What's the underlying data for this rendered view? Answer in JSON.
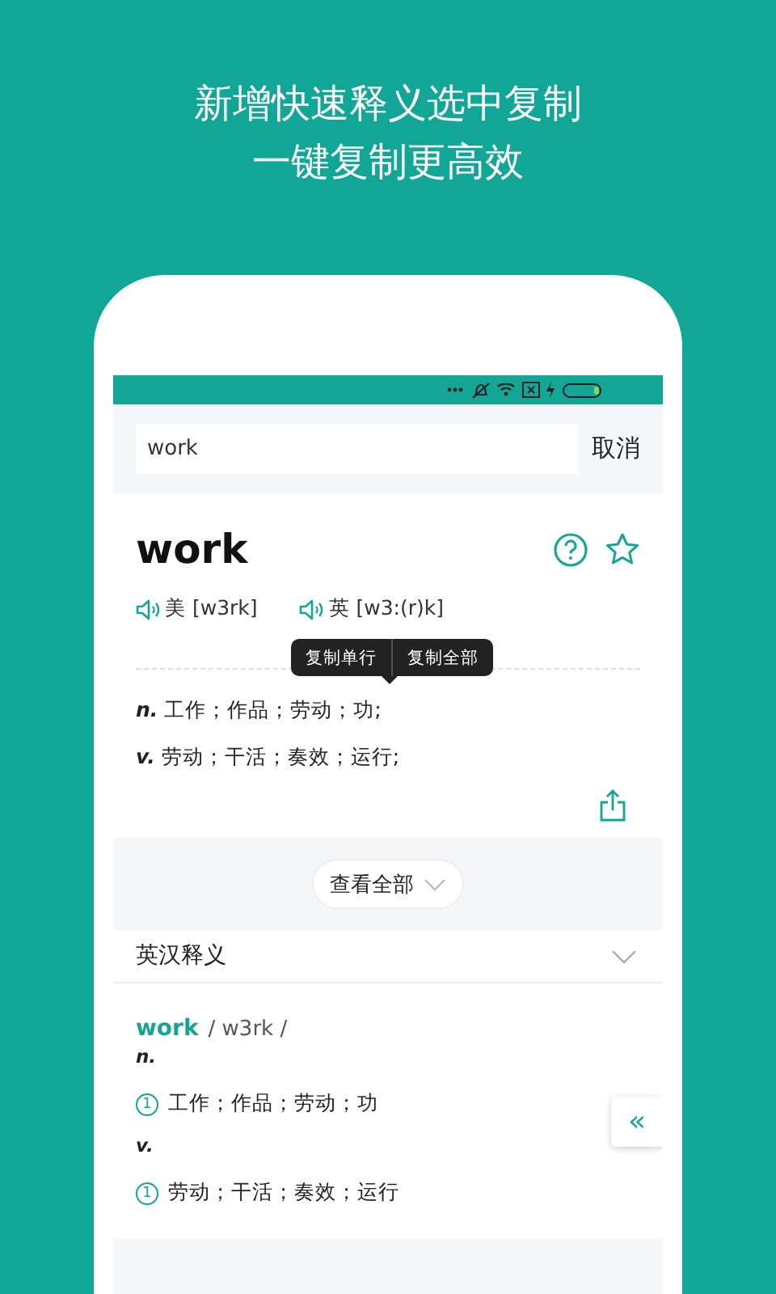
{
  "headline": [
    "新增快速释义选中复制",
    "一键复制更高效"
  ],
  "search": {
    "value": "work",
    "cancel": "取消"
  },
  "entry": {
    "word": "work",
    "pronunciations": [
      {
        "region": "美",
        "ipa": "[w3rk]"
      },
      {
        "region": "英",
        "ipa": "[w3:(r)k]"
      }
    ],
    "copy_menu": [
      "复制单行",
      "复制全部"
    ],
    "definitions": [
      {
        "pos": "n.",
        "text": "工作；作品；劳动；功;"
      },
      {
        "pos": "v.",
        "text": "劳动；干活；奏效；运行;"
      }
    ]
  },
  "view_all": "查看全部",
  "section": {
    "title": "英汉释义",
    "word": "work",
    "phonetic": "/ w3rk /",
    "groups": [
      {
        "pos": "n.",
        "senses": [
          {
            "num": "1",
            "text": "工作；作品；劳动；功"
          }
        ]
      },
      {
        "pos": "v.",
        "senses": [
          {
            "num": "1",
            "text": "劳动；干活；奏效；运行"
          }
        ]
      }
    ]
  },
  "side_tab": "«"
}
